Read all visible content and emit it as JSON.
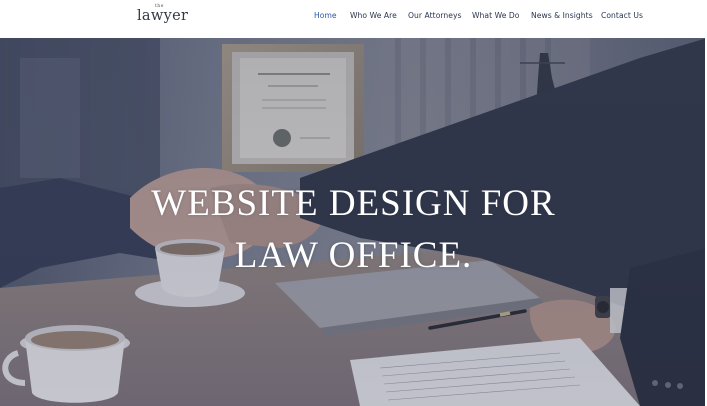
{
  "site": {
    "logo_small": "the",
    "logo_word": "lawyer"
  },
  "nav": {
    "items": [
      {
        "label": "Home",
        "active": true
      },
      {
        "label": "Who We Are",
        "active": false
      },
      {
        "label": "Our Attorneys",
        "active": false
      },
      {
        "label": "What We Do",
        "active": false
      },
      {
        "label": "News & Insights",
        "active": false
      },
      {
        "label": "Contact Us",
        "active": false
      }
    ]
  },
  "hero": {
    "title_line1": "WEBSITE DESIGN FOR",
    "title_line2": "LAW OFFICE."
  },
  "colors": {
    "nav_active": "#2b5aa6",
    "nav_text": "#2a3550",
    "overlay": "#4d5570"
  }
}
